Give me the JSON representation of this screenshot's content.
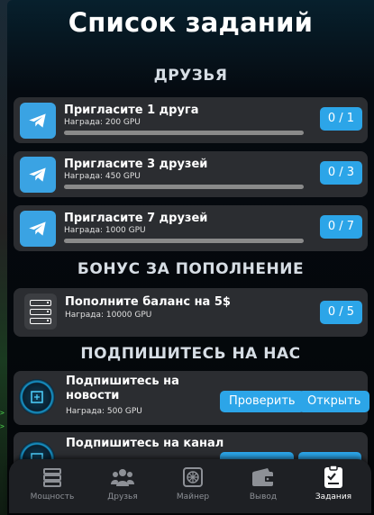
{
  "title": "Список заданий",
  "sections": {
    "friends": "ДРУЗЬЯ",
    "topup": "БОНУС ЗА ПОПОЛНЕНИЕ",
    "subscribe": "ПОДПИШИТЕСЬ НА НАС"
  },
  "friend_tasks": [
    {
      "name": "Пригласите 1 друга",
      "reward": "Награда: 200 GPU",
      "counter": "0 / 1",
      "progress": 0
    },
    {
      "name": "Пригласите 3 друзей",
      "reward": "Награда: 450 GPU",
      "counter": "0 / 3",
      "progress": 0
    },
    {
      "name": "Пригласите 7 друзей",
      "reward": "Награда: 1000 GPU",
      "counter": "0 / 7",
      "progress": 0
    }
  ],
  "topup_task": {
    "name": "Пополните баланс на 5$",
    "reward": "Награда: 10000 GPU",
    "counter": "0 / 5"
  },
  "subscribe_tasks": [
    {
      "name_line1": "Подпишитесь на",
      "name_line2": "новости",
      "reward": "Награда: 500 GPU",
      "check_label": "Проверить",
      "open_label": "Открыть"
    },
    {
      "name_line1": "Подпишитесь на канал",
      "name_line2": "",
      "reward": "",
      "check_label": "",
      "open_label": ""
    }
  ],
  "nav": [
    {
      "label": "Мощность",
      "icon": "server-icon",
      "active": false
    },
    {
      "label": "Друзья",
      "icon": "people-icon",
      "active": false
    },
    {
      "label": "Майнер",
      "icon": "fan-icon",
      "active": false
    },
    {
      "label": "Вывод",
      "icon": "wallet-icon",
      "active": false
    },
    {
      "label": "Задания",
      "icon": "tasks-icon",
      "active": true
    }
  ],
  "colors": {
    "accent": "#2ca5e8",
    "card": "#2b2d31",
    "telegram": "#3aa3e3",
    "navbar": "#1e2024"
  }
}
